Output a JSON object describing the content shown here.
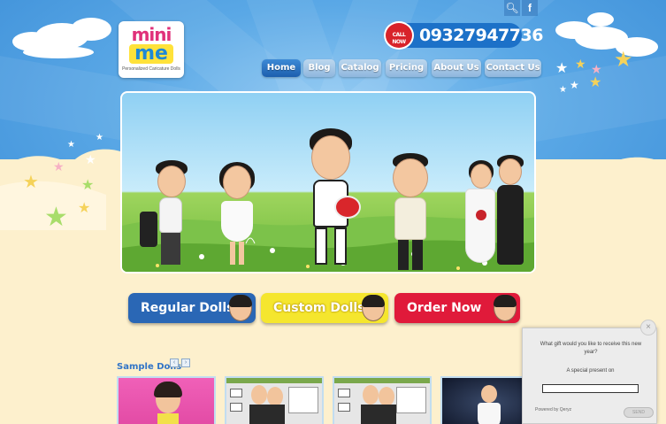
{
  "header": {
    "logo": {
      "line1": "mini",
      "line2": "me",
      "tagline": "Personalized Caricature Dolls"
    },
    "phone_number": "09327947736",
    "phone_badge": "CALL NOW",
    "top_icons": [
      "search-icon",
      "facebook-icon"
    ]
  },
  "nav": {
    "items": [
      {
        "label": "Home",
        "active": true
      },
      {
        "label": "Blog",
        "active": false
      },
      {
        "label": "Catalog",
        "active": false
      },
      {
        "label": "Pricing",
        "active": false
      },
      {
        "label": "About Us",
        "active": false
      },
      {
        "label": "Contact Us",
        "active": false
      }
    ]
  },
  "cta_buttons": [
    {
      "label": "Regular Dolls",
      "bg": "#2a67b5",
      "fg": "#ffffff"
    },
    {
      "label": "Custom Dolls",
      "bg": "#f5e62e",
      "fg": "#ffffff"
    },
    {
      "label": "Order Now",
      "bg": "#e01a3a",
      "fg": "#ffffff"
    }
  ],
  "samples": {
    "title": "Sample Dolls",
    "prev": "‹",
    "next": "›"
  },
  "popup": {
    "close": "×",
    "question": "What gift would you like to receive this new year?",
    "subtext": "A special present on",
    "input_value": "",
    "powered_by": "Powered by Qeryz",
    "send": "SEND"
  },
  "colors": {
    "sky": "#4a9ae0",
    "accent_blue": "#1c71c8",
    "cream": "#fdf0cd"
  }
}
